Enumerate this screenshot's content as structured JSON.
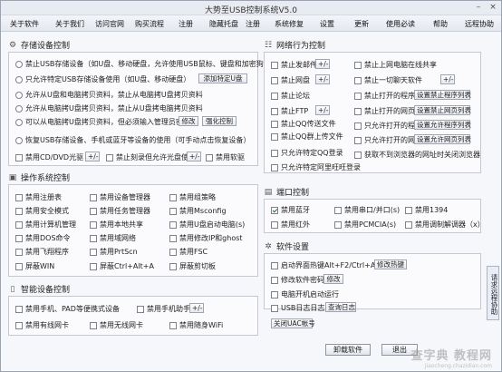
{
  "window": {
    "title": "大势至USB控制系统V5.0"
  },
  "menu": [
    "关于软件",
    "关于我们",
    "访问官网",
    "购买流程",
    "注册",
    "隐藏托盘",
    "注册",
    "系统修复",
    "设置",
    "更新",
    "使用必读",
    "帮助",
    "远程协助"
  ],
  "storage": {
    "title": "存储设备控制",
    "radios": [
      "禁止USB存储设备（如U盘、移动硬盘，允许使用USB鼠标、键盘和加密狗）",
      "只允许特定USB存储设备使用（如U盘、移动硬盘）",
      "允许从U盘和电脑拷贝资料，禁止从电脑拷U盘拷贝资料",
      "允许从电脑拷U盘拷贝资料，禁止从U盘拷电脑拷贝资料",
      "可以从电脑拷U盘拷贝资料，但必须输入管理员密码",
      "恢复USB存储设备、手机或蓝牙等设备的使用（可手动点击恢复设备）"
    ],
    "btn_add_u": "添加特定U盘",
    "btn_modify": "修改",
    "btn_strong": "强化控制",
    "cb_cd": "禁用CD/DVD光驱",
    "cb_cd_allow": "禁止刻录但允许光盘使用",
    "cb_floppy": "禁用软驱"
  },
  "network": {
    "title": "网络行为控制",
    "left": [
      "禁止发邮件",
      "禁止网盘",
      "禁止论坛",
      "禁止FTP",
      "禁止QQ传送文件",
      "禁止QQ群上传文件",
      "只允许特定QQ登录",
      "只允许特定阿里旺旺登录"
    ],
    "right": [
      "禁止上网电脑在线共享",
      "禁止一切聊天软件",
      "禁止打开的程序",
      "禁止打开的网页",
      "只允许打开的程序",
      "只允许打开的网页",
      "获取不到浏览器的网址时关闭浏览器"
    ],
    "btn_set_program": "设置禁止程序列表",
    "btn_set_web": "设置禁止网页列表",
    "btn_set_allow_program": "设置允许程序列表",
    "btn_set_allow_web": "设置允许网页列表",
    "plus": "+/-"
  },
  "os": {
    "title": "操作系统控制",
    "items": [
      "禁用注册表",
      "禁用安全模式",
      "禁用计算机管理",
      "禁用DOS命令",
      "禁用飞翔程序",
      "屏蔽WIN",
      "禁用设备管理器",
      "禁用任务管理器",
      "禁用本地共享",
      "禁用域网络",
      "禁用PrtScn",
      "屏蔽Ctrl+Alt+A",
      "禁用组策略",
      "禁用Msconfig",
      "禁用U盘启动电脑(s)",
      "禁用修改IP和ghost",
      "禁用FSC",
      "屏蔽剪切板"
    ]
  },
  "port": {
    "title": "端口控制",
    "items": [
      "禁用蓝牙",
      "禁用串口/并口(s)",
      "禁用1394",
      "禁用红外",
      "禁用PCMCIA(s)",
      "禁用调制解调器（x）"
    ]
  },
  "smart": {
    "title": "智能设备控制",
    "items": [
      "禁用手机、PAD等便携式设备",
      "禁用手机助手",
      "禁用有线网卡",
      "禁用无线网卡",
      "禁用随身WiFi"
    ],
    "plus": "+/-"
  },
  "software": {
    "title": "软件设置",
    "items": [
      "启动界面热键Alt+F2/Ctrl+Alt+2",
      "修改软件密码",
      "电脑开机启动运行",
      "USB日志日志"
    ],
    "btn_hotkey": "修改热键",
    "btn_modify": "修改",
    "btn_log": "查询日志",
    "btn_uac": "关闭UAC帐号"
  },
  "sidebar": "请求远程协助",
  "uninstall": "卸载软件",
  "exit": "退出",
  "watermark": {
    "line1": "查字典 教程网",
    "line2": "jiaocheng.chazidian.com"
  }
}
